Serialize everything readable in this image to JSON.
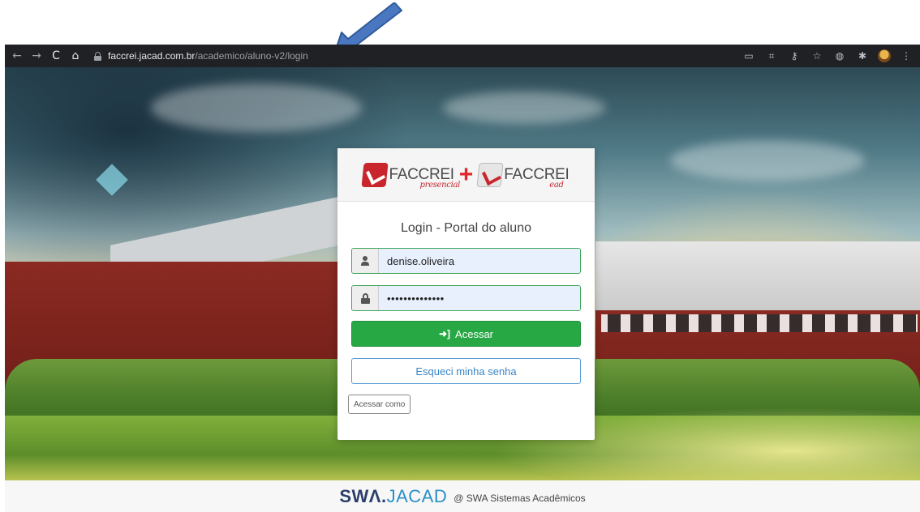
{
  "browser": {
    "url_host": "faccrei.jacad.com.br",
    "url_path": "/academico/aluno-v2/login",
    "icons": [
      "back-icon",
      "forward-icon",
      "reload-icon",
      "home-icon",
      "lock-icon",
      "cast-icon",
      "qr-icon",
      "key-icon",
      "star-icon",
      "extension-icon",
      "puzzle-icon",
      "profile-avatar",
      "menu-icon"
    ]
  },
  "logo": {
    "left_text": "FACCREI",
    "left_sub": "presencial",
    "plus": "+",
    "right_text": "FACCREI",
    "right_sub": "ead"
  },
  "login": {
    "title": "Login - Portal do aluno",
    "username": "denise.oliveira",
    "password": "••••••••••••••",
    "submit_label": "Acessar",
    "forgot_label": "Esqueci minha senha",
    "access_as_label": "Acessar como"
  },
  "footer": {
    "brand_swa": "SWΛ",
    "brand_dot": ".",
    "brand_jacad": "JACAD",
    "copyright": "@ SWA Sistemas Acadêmicos"
  },
  "colors": {
    "success": "#28a745",
    "link": "#3a86c8",
    "brand_red": "#c8262c",
    "arrow": "#4a78c0"
  }
}
